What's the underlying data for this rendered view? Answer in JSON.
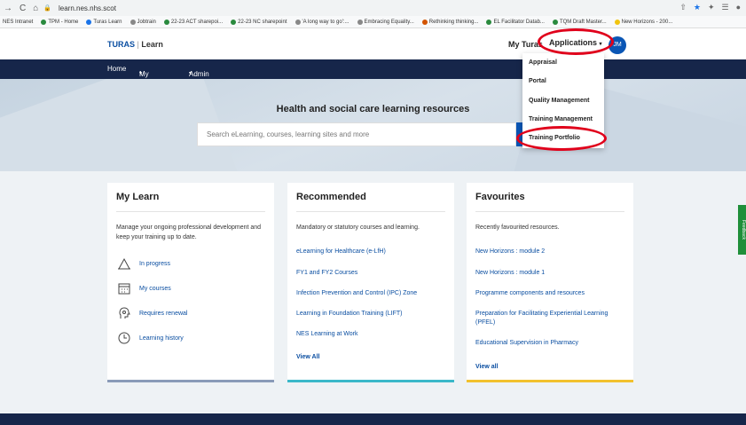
{
  "browser": {
    "url": "learn.nes.nhs.scot",
    "bookmarks": [
      {
        "label": "NES Intranet",
        "color": ""
      },
      {
        "label": "TPM - Home",
        "color": "#2a8a3e"
      },
      {
        "label": "Turas Learn",
        "color": "#1a73e8"
      },
      {
        "label": "Jobtrain",
        "color": "#888888"
      },
      {
        "label": "22-23 ACT sharepoi...",
        "color": "#2a8a3e"
      },
      {
        "label": "22-23 NC sharepoint",
        "color": "#2a8a3e"
      },
      {
        "label": "'A long way to go':...",
        "color": "#888888"
      },
      {
        "label": "Embracing Equality...",
        "color": "#888888"
      },
      {
        "label": "Rethinking thinking...",
        "color": "#d35400"
      },
      {
        "label": "EL Facilitator Datab...",
        "color": "#2a8a3e"
      },
      {
        "label": "TQM Draft Master...",
        "color": "#2a8a3e"
      },
      {
        "label": "New Horizons - 200...",
        "color": "#f1c40f"
      }
    ]
  },
  "header": {
    "brand": "TURAS",
    "brand_sep": "|",
    "brand_sub": "Learn",
    "my_turas": "My Turas",
    "applications": "Applications",
    "avatar_text": "JM"
  },
  "topnav": {
    "home": "Home",
    "my_learn": "My Learn",
    "admin": "Admin"
  },
  "hero": {
    "title": "Health and social care learning resources",
    "search_placeholder": "Search eLearning, courses, learning sites and more"
  },
  "dropdown": {
    "items": [
      "Appraisal",
      "Portal",
      "Quality Management",
      "Training Management",
      "Training Portfolio"
    ]
  },
  "cards": {
    "my_learn": {
      "title": "My Learn",
      "desc": "Manage your ongoing professional development and keep your training up to date.",
      "items": [
        "In progress",
        "My courses",
        "Requires renewal",
        "Learning history"
      ],
      "bar_color": "#8a9bb8"
    },
    "recommended": {
      "title": "Recommended",
      "desc": "Mandatory or statutory courses and learning.",
      "links": [
        "eLearning for Healthcare (e-LfH)",
        "FY1 and FY2 Courses",
        "Infection Prevention and Control (IPC) Zone",
        "Learning in Foundation Training (LIFT)",
        "NES Learning at Work"
      ],
      "view_all": "View All",
      "bar_color": "#3bb8c9"
    },
    "favourites": {
      "title": "Favourites",
      "desc": "Recently favourited resources.",
      "links": [
        "New Horizons : module 2",
        "New Horizons : module 1",
        "Programme components and resources",
        "Preparation for Facilitating Experiential Learning (PFEL)",
        "Educational Supervision in Pharmacy"
      ],
      "view_all": "View all",
      "bar_color": "#f2c12e"
    }
  },
  "feedback": "Feedback"
}
